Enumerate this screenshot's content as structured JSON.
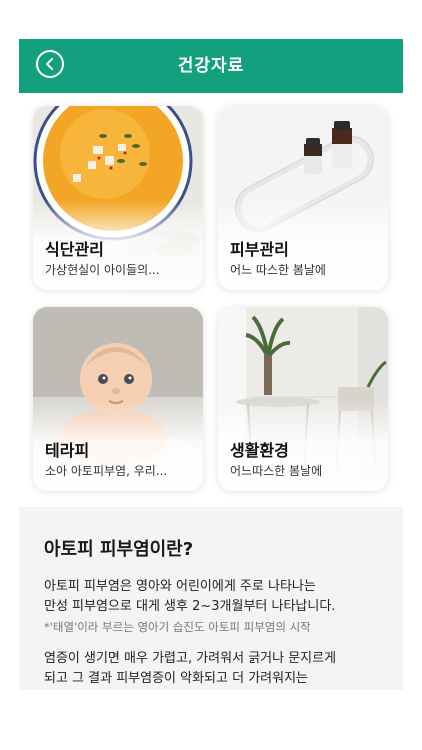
{
  "header": {
    "title": "건강자료",
    "back_icon": "chevron-left-icon"
  },
  "cards": [
    {
      "title": "식단관리",
      "desc": "가상현실이 아이들의..."
    },
    {
      "title": "피부관리",
      "desc": "어느 따스한 봄날에"
    },
    {
      "title": "테라피",
      "desc": "소아 아토피부염, 우리..."
    },
    {
      "title": "생활환경",
      "desc": "어느따스한 봄날에"
    }
  ],
  "info": {
    "title": "아토피 피부염이란?",
    "line1": "아토피 피부염은 영아와 어린이에게 주로 나타나는",
    "line2": "만성 피부염으로 대게 생후 2~3개월부터 나타납니다.",
    "note": "*'태열'이라 부르는 영아기 습진도 아토피 피부염의 시작",
    "line3": "염증이 생기면 매우 가렵고, 가려워서 긁거나 문지르게",
    "line4": "되고 그 결과 피부염증이 악화되고 더 가려워지는"
  },
  "colors": {
    "brand": "#13a07e",
    "panel": "#f4f4f4"
  }
}
